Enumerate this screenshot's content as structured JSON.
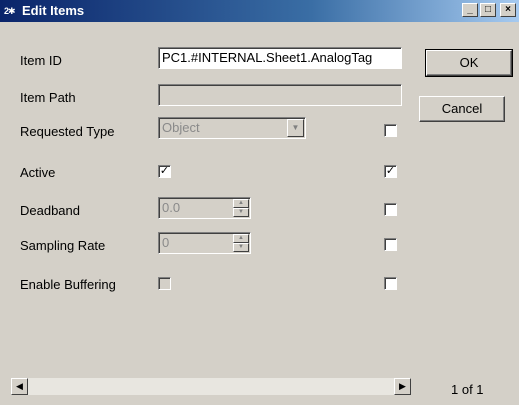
{
  "window": {
    "icon_text": "2✱",
    "title": "Edit Items",
    "minimize": "_",
    "maximize": "□",
    "close": "×"
  },
  "fields": {
    "item_id": {
      "label": "Item ID",
      "value": "PC1.#INTERNAL.Sheet1.AnalogTag"
    },
    "item_path": {
      "label": "Item Path",
      "value": ""
    },
    "requested_type": {
      "label": "Requested Type",
      "value": "Object",
      "right_checked": false
    },
    "active": {
      "label": "Active",
      "checked": true,
      "right_checked": true
    },
    "deadband": {
      "label": "Deadband",
      "value": "0.0",
      "right_checked": false
    },
    "sampling_rate": {
      "label": "Sampling Rate",
      "value": "0",
      "right_checked": false
    },
    "enable_buffering": {
      "label": "Enable Buffering",
      "checked": false,
      "right_checked": false
    }
  },
  "buttons": {
    "ok": "OK",
    "cancel": "Cancel"
  },
  "pager": "1 of 1",
  "glyphs": {
    "check": "✓",
    "left_arrow": "◀",
    "right_arrow": "▶",
    "down_arrow": "▼",
    "up_arrow": "▲"
  }
}
